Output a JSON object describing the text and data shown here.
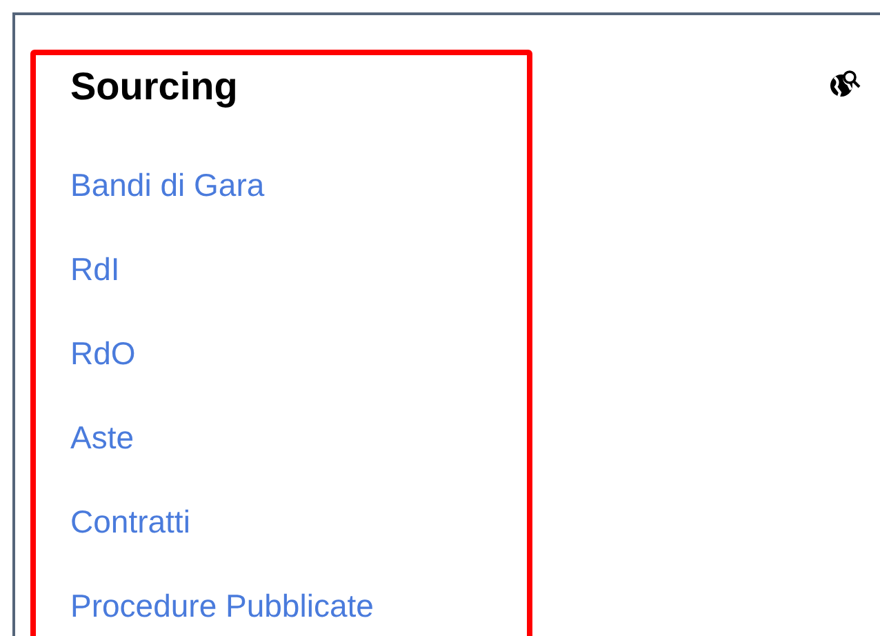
{
  "section": {
    "title": "Sourcing",
    "links": [
      {
        "label": "Bandi di Gara"
      },
      {
        "label": "RdI"
      },
      {
        "label": "RdO"
      },
      {
        "label": "Aste"
      },
      {
        "label": "Contratti"
      },
      {
        "label": "Procedure Pubblicate"
      }
    ]
  }
}
